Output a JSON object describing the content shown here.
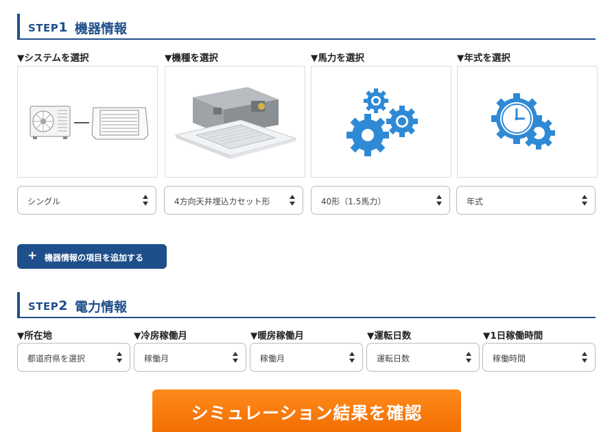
{
  "step1": {
    "step_label": "STEP",
    "step_number": "1",
    "title": "機器情報",
    "columns": [
      {
        "label": "▼システムを選択",
        "selected": "シングル"
      },
      {
        "label": "▼機種を選択",
        "selected": "4方向天井埋込カセット形"
      },
      {
        "label": "▼馬力を選択",
        "selected": "40形（1.5馬力）"
      },
      {
        "label": "▼年式を選択",
        "selected": "年式"
      }
    ],
    "add_button": {
      "icon": "+",
      "label": "機器情報の項目を追加する"
    }
  },
  "step2": {
    "step_label": "STEP",
    "step_number": "2",
    "title": "電力情報",
    "fields": [
      {
        "label": "▼所在地",
        "selected": "都道府県を選択"
      },
      {
        "label": "▼冷房稼働月",
        "selected": "稼働月"
      },
      {
        "label": "▼暖房稼働月",
        "selected": "稼働月"
      },
      {
        "label": "▼運転日数",
        "selected": "運転日数"
      },
      {
        "label": "▼1日稼働時間",
        "selected": "稼働時間"
      }
    ]
  },
  "cta": {
    "label": "シミュレーション結果を確認"
  },
  "colors": {
    "accent_blue": "#1f4f8b",
    "icon_blue": "#2f8ad6",
    "cta_orange": "#f57a0c"
  },
  "icons": {
    "system": "outdoor-unit-and-cassette-icon",
    "model": "ceiling-cassette-unit-image",
    "horsepower": "gears-icon",
    "year": "clock-gear-icon"
  }
}
